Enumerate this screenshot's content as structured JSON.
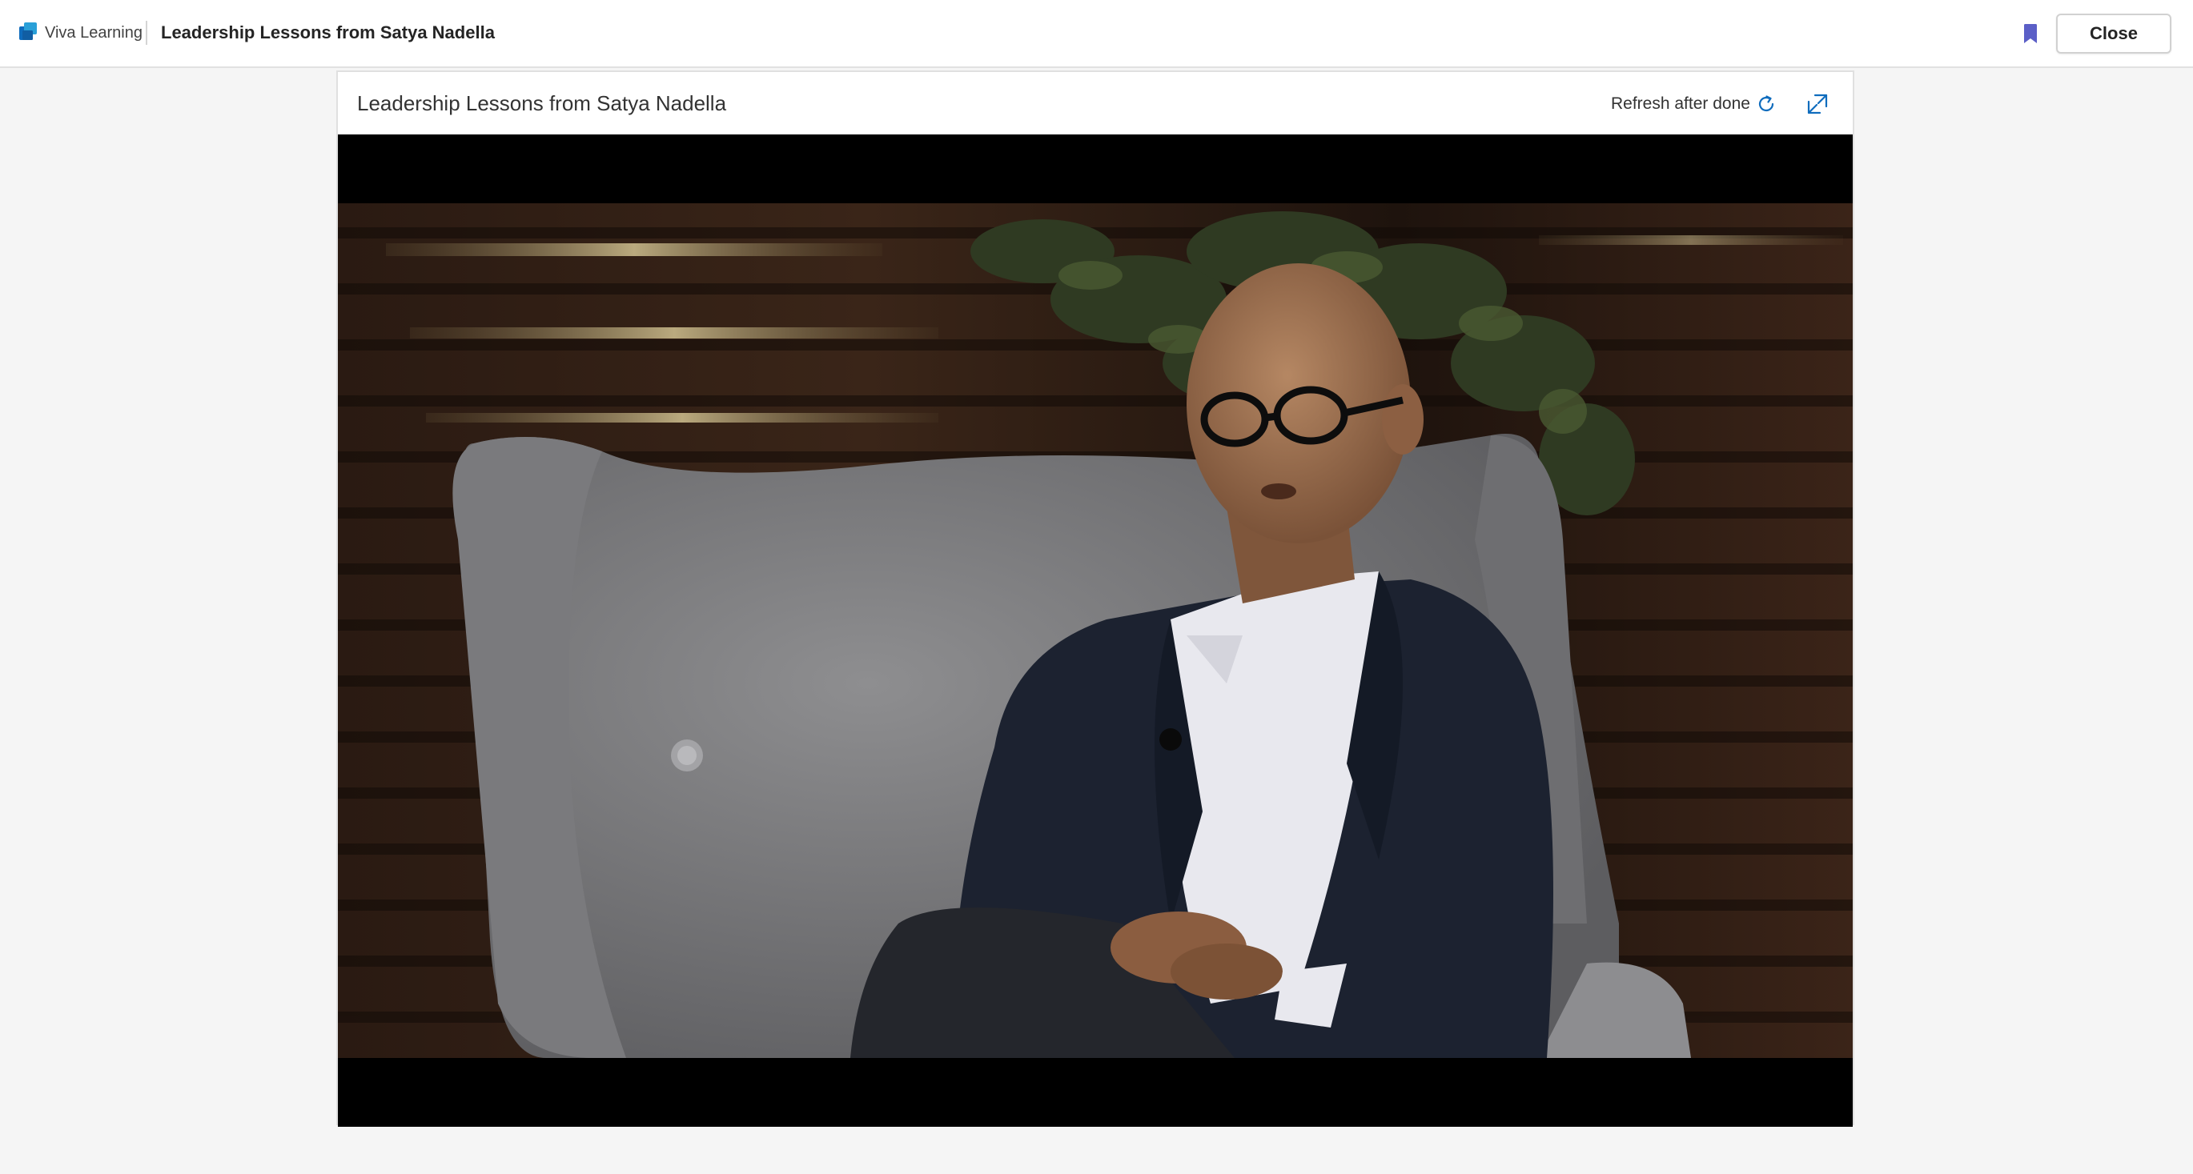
{
  "app": {
    "name": "Viva Learning",
    "page_title": "Leadership Lessons from Satya Nadella",
    "logo_icon": "viva-learning-logo-icon"
  },
  "actions": {
    "bookmark_icon": "bookmark-icon",
    "close_label": "Close"
  },
  "content": {
    "title": "Leadership Lessons from Satya Nadella",
    "refresh_label": "Refresh after done",
    "refresh_icon": "refresh-icon",
    "expand_icon": "expand-icon"
  },
  "colors": {
    "accent": "#5b5fc7",
    "icon_blue": "#0f6cbd",
    "video_bg": "#000000"
  }
}
